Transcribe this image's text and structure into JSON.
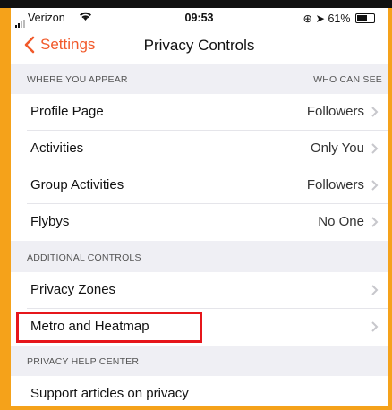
{
  "status_bar": {
    "carrier": "Verizon",
    "time": "09:53",
    "battery": "61%"
  },
  "nav": {
    "back_label": "Settings",
    "title": "Privacy Controls"
  },
  "sections": [
    {
      "header": "WHERE YOU APPEAR",
      "header_right": "WHO CAN SEE",
      "rows": [
        {
          "label": "Profile Page",
          "value": "Followers"
        },
        {
          "label": "Activities",
          "value": "Only You"
        },
        {
          "label": "Group Activities",
          "value": "Followers"
        },
        {
          "label": "Flybys",
          "value": "No One"
        }
      ]
    },
    {
      "header": "ADDITIONAL CONTROLS",
      "rows": [
        {
          "label": "Privacy Zones"
        },
        {
          "label": "Metro and Heatmap"
        }
      ]
    },
    {
      "header": "PRIVACY HELP CENTER",
      "rows": [
        {
          "label": "Support articles on privacy"
        }
      ]
    }
  ],
  "colors": {
    "accent": "#f1592a",
    "frame": "#f5a21a",
    "highlight": "#e6161b"
  }
}
